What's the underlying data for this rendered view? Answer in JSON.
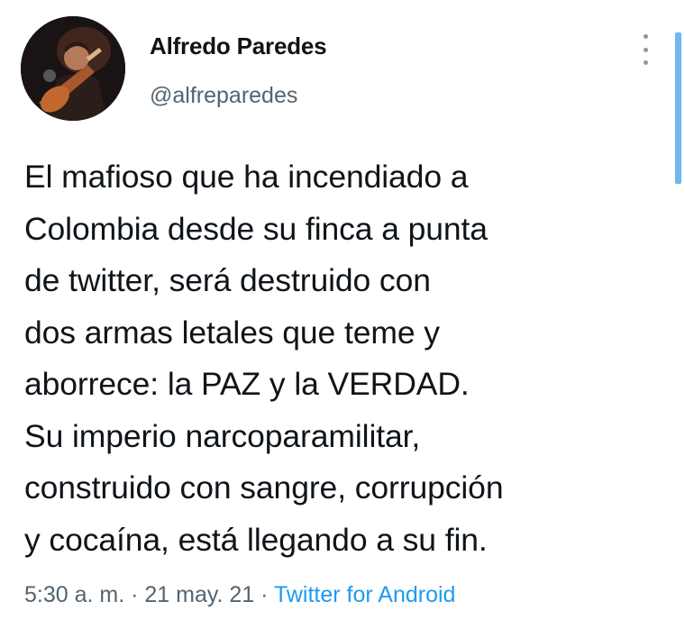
{
  "user": {
    "name": "Alfredo Paredes",
    "handle": "@alfreparedes"
  },
  "tweet": {
    "text": "El mafioso que ha incendiado a\nColombia desde su finca a punta\nde twitter, será destruido con\ndos armas letales que teme y\naborrece: la PAZ y la VERDAD.\nSu imperio narcoparamilitar,\nconstruido con sangre, corrupción\ny cocaína, está llegando a su fin."
  },
  "meta": {
    "time": "5:30 a. m.",
    "separator": " · ",
    "date": "21 may. 21",
    "source": "Twitter for Android"
  },
  "colors": {
    "text": "#0f1419",
    "secondary": "#536471",
    "link": "#1d9bf0",
    "scrollbar": "#6db8ef"
  },
  "icons": {
    "more": "more-vertical-icon"
  }
}
